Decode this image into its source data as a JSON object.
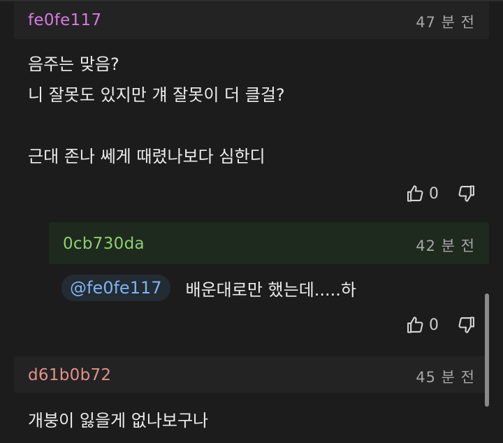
{
  "comments": [
    {
      "username": "fe0fe117",
      "time": "47 분 전",
      "lines": [
        "음주는 맞음?",
        "니 잘못도 있지만 걔 잘못이 더 클걸?",
        "근대 존나 쎄게 때렸나보다 심한디"
      ],
      "likes": "0",
      "reply": {
        "username": "0cb730da",
        "time": "42 분 전",
        "mention": "@fe0fe117",
        "text": "배운대로만 했는데.....하",
        "likes": "0"
      }
    },
    {
      "username": "d61b0b72",
      "time": "45 분 전",
      "text": "개붕이 잃을게 없나보구나"
    }
  ],
  "colors": {
    "background": "#1c1c1c",
    "header_bg": "#232323",
    "reply_header_bg": "#1f2a1f",
    "username_1": "#d77be0",
    "username_reply": "#8ccf6e",
    "username_2": "#e2918a",
    "mention": "#7fb4ee"
  },
  "icons": [
    "thumbs-up-icon",
    "thumbs-down-icon"
  ]
}
